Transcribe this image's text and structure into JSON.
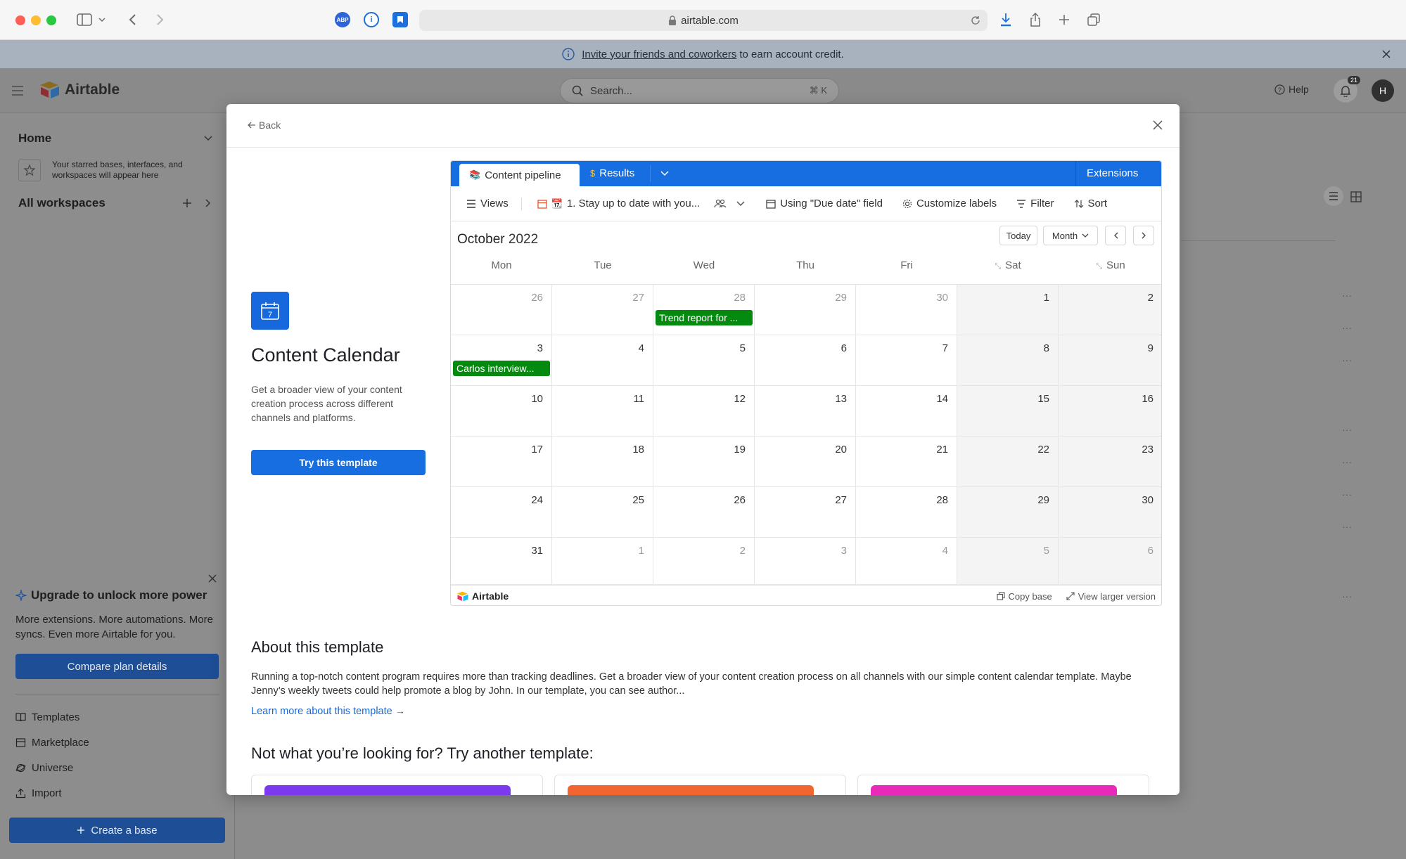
{
  "browser": {
    "url": "airtable.com"
  },
  "banner": {
    "link_text": "Invite your friends and coworkers",
    "text": "to earn account credit."
  },
  "header": {
    "logo": "Airtable",
    "search_placeholder": "Search...",
    "search_shortcut": "⌘ K",
    "help_label": "Help",
    "notification_count": "21",
    "avatar_initial": "H"
  },
  "sidebar": {
    "home_label": "Home",
    "starred_hint": "Your starred bases, interfaces, and workspaces will appear here",
    "all_workspaces": "All workspaces",
    "upgrade_title": "Upgrade to unlock more power",
    "upgrade_body": "More extensions. More automations. More syncs. Even more Airtable for you.",
    "compare_button": "Compare plan details",
    "links": [
      "Templates",
      "Marketplace",
      "Universe",
      "Import"
    ],
    "create_button": "Create a base"
  },
  "modal": {
    "back_label": "Back",
    "template_title": "Content Calendar",
    "template_desc": "Get a broader view of your content creation process across different channels and platforms.",
    "try_button": "Try this template",
    "about_title": "About this template",
    "about_text": "Running a top-notch content program requires more than tracking deadlines. Get a broader view of your content creation process on all channels with our simple content calendar template. Maybe Jenny’s weekly tweets could help promote a blog by John. In our template, you can see author...",
    "learn_more": "Learn more about this template →",
    "another_title": "Not what you’re looking for? Try another template:",
    "card_colors": [
      "#7c39ed",
      "#f26531",
      "#e929ba"
    ]
  },
  "embed": {
    "tab_active": "Content pipeline",
    "tab_results": "Results",
    "extensions": "Extensions",
    "views": "Views",
    "view_name": "1. Stay up to date with you...",
    "date_field": "Using \"Due date\" field",
    "customize_labels": "Customize labels",
    "filter": "Filter",
    "sort": "Sort",
    "month_name": "October",
    "year": "2022",
    "today_btn": "Today",
    "month_btn": "Month",
    "days": [
      "Mon",
      "Tue",
      "Wed",
      "Thu",
      "Fri",
      "Sat",
      "Sun"
    ],
    "weeks": [
      [
        "26",
        "27",
        "28",
        "29",
        "30",
        "1",
        "2"
      ],
      [
        "3",
        "4",
        "5",
        "6",
        "7",
        "8",
        "9"
      ],
      [
        "10",
        "11",
        "12",
        "13",
        "14",
        "15",
        "16"
      ],
      [
        "17",
        "18",
        "19",
        "20",
        "21",
        "22",
        "23"
      ],
      [
        "24",
        "25",
        "26",
        "27",
        "28",
        "29",
        "30"
      ],
      [
        "31",
        "1",
        "2",
        "3",
        "4",
        "5",
        "6"
      ]
    ],
    "events": {
      "wed_wk1": "Trend report for ...",
      "mon_wk2": "Carlos interview..."
    },
    "footer_logo": "Airtable",
    "copy_base": "Copy base",
    "view_larger": "View larger version"
  }
}
